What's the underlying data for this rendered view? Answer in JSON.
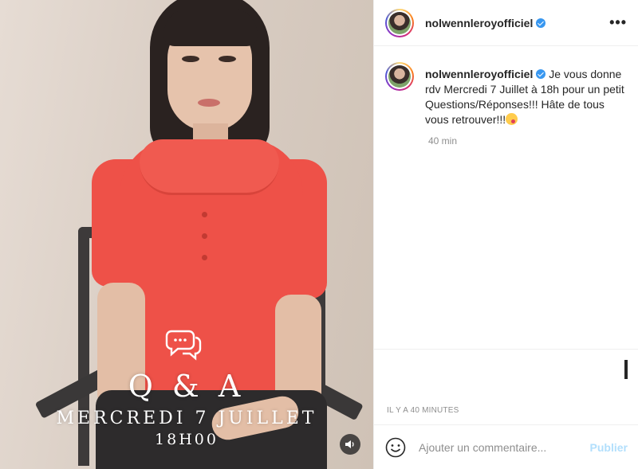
{
  "post": {
    "username": "nolwennleroyofficiel",
    "verified": true,
    "caption_text": "Je vous donne rdv Mercredi 7 Juillet à 18h pour un petit Questions/Réponses!!! Hâte de tous vous retrouver!!!",
    "caption_emoji": "face-blowing-kiss",
    "caption_time": "40 min",
    "posted_ago": "IL Y A 40 MINUTES"
  },
  "video_overlay": {
    "icon": "speech-bubbles-icon",
    "title": "Q & A",
    "date": "MERCREDI 7 JUILLET",
    "time": "18H00"
  },
  "header": {
    "more_label": "•••"
  },
  "comment": {
    "placeholder": "Ajouter un commentaire...",
    "publish_label": "Publier"
  },
  "colors": {
    "accent_blue": "#3897f0",
    "publish_disabled": "#b2dffc",
    "secondary_text": "#8e8e8e",
    "shirt": "#ee5148"
  }
}
